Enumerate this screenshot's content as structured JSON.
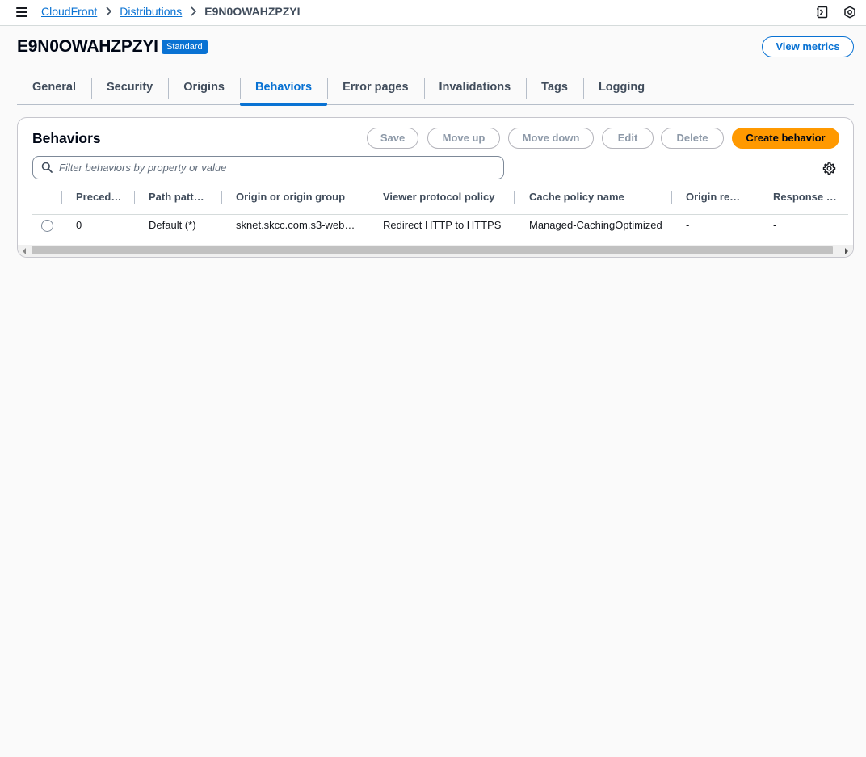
{
  "breadcrumb": {
    "items": [
      "CloudFront",
      "Distributions"
    ],
    "current": "E9N0OWAHZPZYI"
  },
  "header": {
    "title": "E9N0OWAHZPZYI",
    "badge": "Standard",
    "view_metrics_label": "View metrics"
  },
  "tabs": [
    {
      "label": "General",
      "active": false
    },
    {
      "label": "Security",
      "active": false
    },
    {
      "label": "Origins",
      "active": false
    },
    {
      "label": "Behaviors",
      "active": true
    },
    {
      "label": "Error pages",
      "active": false
    },
    {
      "label": "Invalidations",
      "active": false
    },
    {
      "label": "Tags",
      "active": false
    },
    {
      "label": "Logging",
      "active": false
    }
  ],
  "behaviors": {
    "title": "Behaviors",
    "actions": {
      "save": "Save",
      "move_up": "Move up",
      "move_down": "Move down",
      "edit": "Edit",
      "delete": "Delete",
      "create": "Create behavior"
    },
    "filter_placeholder": "Filter behaviors by property or value",
    "columns": [
      "Preced…",
      "Path patt…",
      "Origin or origin group",
      "Viewer protocol policy",
      "Cache policy name",
      "Origin re…",
      "Response …"
    ],
    "rows": [
      [
        "0",
        "Default (*)",
        "sknet.skcc.com.s3-web…",
        "Redirect HTTP to HTTPS",
        "Managed-CachingOptimized",
        "-",
        "-"
      ]
    ]
  },
  "colors": {
    "link": "#0972d3",
    "primary_button": "#ff9900",
    "badge": "#0972d3"
  },
  "icons": [
    "menu-icon",
    "chevron-right-icon",
    "notes-icon",
    "help-hexagon-icon",
    "search-icon",
    "settings-gear-icon"
  ]
}
